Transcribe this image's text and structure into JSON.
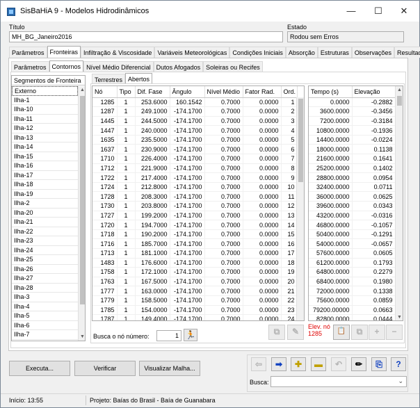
{
  "window": {
    "title": "SisBaHiA 9 - Modelos Hidrodinâmicos",
    "minimize": "—",
    "maximize": "☐",
    "close": "✕"
  },
  "header": {
    "titulo_label": "Título",
    "titulo_value": "MH_BG_Janeiro2016",
    "estado_label": "Estado",
    "estado_value": "Rodou sem Erros"
  },
  "main_tabs": [
    "Parâmetros",
    "Fronteiras",
    "Infiltração & Viscosidade",
    "Variáveis Meteorológicas",
    "Condições Iniciais",
    "Absorção",
    "Estruturas",
    "Observações",
    "Resultados"
  ],
  "sub_tabs": [
    "Parâmetros",
    "Contornos",
    "Nível Médio Diferencial",
    "Dutos Afogados",
    "Soleiras ou Recifes"
  ],
  "inner_tabs": [
    "Terrestres",
    "Abertos"
  ],
  "segments": {
    "header": "Segmentos de Fronteira",
    "items": [
      "Externo",
      "Ilha-1",
      "Ilha-10",
      "Ilha-11",
      "Ilha-12",
      "Ilha-13",
      "Ilha-14",
      "Ilha-15",
      "Ilha-16",
      "Ilha-17",
      "Ilha-18",
      "Ilha-19",
      "Ilha-2",
      "Ilha-20",
      "Ilha-21",
      "Ilha-22",
      "Ilha-23",
      "Ilha-24",
      "Ilha-25",
      "Ilha-26",
      "Ilha-27",
      "Ilha-28",
      "Ilha-3",
      "Ilha-4",
      "Ilha-5",
      "Ilha-6",
      "Ilha-7"
    ]
  },
  "nodes_table": {
    "columns": [
      "Nó",
      "Tipo",
      "Dif. Fase",
      "Ângulo",
      "Nível Médio",
      "Fator Rad.",
      "Ord."
    ],
    "rows": [
      [
        "1285",
        "1",
        "253.6000",
        "160.1542",
        "0.7000",
        "0.0000",
        "1"
      ],
      [
        "1287",
        "1",
        "249.1000",
        "-174.1700",
        "0.7000",
        "0.0000",
        "2"
      ],
      [
        "1445",
        "1",
        "244.5000",
        "-174.1700",
        "0.7000",
        "0.0000",
        "3"
      ],
      [
        "1447",
        "1",
        "240.0000",
        "-174.1700",
        "0.7000",
        "0.0000",
        "4"
      ],
      [
        "1635",
        "1",
        "235.5000",
        "-174.1700",
        "0.7000",
        "0.0000",
        "5"
      ],
      [
        "1637",
        "1",
        "230.9000",
        "-174.1700",
        "0.7000",
        "0.0000",
        "6"
      ],
      [
        "1710",
        "1",
        "226.4000",
        "-174.1700",
        "0.7000",
        "0.0000",
        "7"
      ],
      [
        "1712",
        "1",
        "221.9000",
        "-174.1700",
        "0.7000",
        "0.0000",
        "8"
      ],
      [
        "1722",
        "1",
        "217.4000",
        "-174.1700",
        "0.7000",
        "0.0000",
        "9"
      ],
      [
        "1724",
        "1",
        "212.8000",
        "-174.1700",
        "0.7000",
        "0.0000",
        "10"
      ],
      [
        "1728",
        "1",
        "208.3000",
        "-174.1700",
        "0.7000",
        "0.0000",
        "11"
      ],
      [
        "1730",
        "1",
        "203.8000",
        "-174.1700",
        "0.7000",
        "0.0000",
        "12"
      ],
      [
        "1727",
        "1",
        "199.2000",
        "-174.1700",
        "0.7000",
        "0.0000",
        "13"
      ],
      [
        "1720",
        "1",
        "194.7000",
        "-174.1700",
        "0.7000",
        "0.0000",
        "14"
      ],
      [
        "1718",
        "1",
        "190.2000",
        "-174.1700",
        "0.7000",
        "0.0000",
        "15"
      ],
      [
        "1716",
        "1",
        "185.7000",
        "-174.1700",
        "0.7000",
        "0.0000",
        "16"
      ],
      [
        "1713",
        "1",
        "181.1000",
        "-174.1700",
        "0.7000",
        "0.0000",
        "17"
      ],
      [
        "1483",
        "1",
        "176.6000",
        "-174.1700",
        "0.7000",
        "0.0000",
        "18"
      ],
      [
        "1758",
        "1",
        "172.1000",
        "-174.1700",
        "0.7000",
        "0.0000",
        "19"
      ],
      [
        "1763",
        "1",
        "167.5000",
        "-174.1700",
        "0.7000",
        "0.0000",
        "20"
      ],
      [
        "1777",
        "1",
        "163.0000",
        "-174.1700",
        "0.7000",
        "0.0000",
        "21"
      ],
      [
        "1779",
        "1",
        "158.5000",
        "-174.1700",
        "0.7000",
        "0.0000",
        "22"
      ],
      [
        "1785",
        "1",
        "154.0000",
        "-174.1700",
        "0.7000",
        "0.0000",
        "23"
      ],
      [
        "1787",
        "1",
        "149.4000",
        "-174.1700",
        "0.7000",
        "0.0000",
        "24"
      ]
    ]
  },
  "time_table": {
    "columns": [
      "Tempo (s)",
      "Elevação"
    ],
    "rows": [
      [
        "0.0000",
        "-0.2882"
      ],
      [
        "3600.0000",
        "-0.3456"
      ],
      [
        "7200.0000",
        "-0.3184"
      ],
      [
        "10800.0000",
        "-0.1936"
      ],
      [
        "14400.0000",
        "-0.0224"
      ],
      [
        "18000.0000",
        "0.1138"
      ],
      [
        "21600.0000",
        "0.1641"
      ],
      [
        "25200.0000",
        "0.1402"
      ],
      [
        "28800.0000",
        "0.0954"
      ],
      [
        "32400.0000",
        "0.0711"
      ],
      [
        "36000.0000",
        "0.0625"
      ],
      [
        "39600.0000",
        "0.0343"
      ],
      [
        "43200.0000",
        "-0.0316"
      ],
      [
        "46800.0000",
        "-0.1057"
      ],
      [
        "50400.0000",
        "-0.1291"
      ],
      [
        "54000.0000",
        "-0.0657"
      ],
      [
        "57600.0000",
        "0.0605"
      ],
      [
        "61200.0000",
        "0.1793"
      ],
      [
        "64800.0000",
        "0.2279"
      ],
      [
        "68400.0000",
        "0.1980"
      ],
      [
        "72000.0000",
        "0.1338"
      ],
      [
        "75600.0000",
        "0.0859"
      ],
      [
        "79200.00000",
        "0.0663"
      ],
      [
        "82800.0000",
        "0.0444"
      ]
    ]
  },
  "busca_no": {
    "label": "Busca o nó número:",
    "value": "1"
  },
  "elev_label": {
    "line1": "Elev. nó",
    "line2": "1285",
    "color": "#e00000"
  },
  "buttons": {
    "executa": "Executa...",
    "verificar": "Verificar",
    "visualizar": "Visualizar Malha..."
  },
  "busca": {
    "label": "Busca:",
    "value": ""
  },
  "status": {
    "inicio": "Início: 13:55",
    "projeto": "Projeto: Baías do Brasil - Baía de Guanabara"
  }
}
